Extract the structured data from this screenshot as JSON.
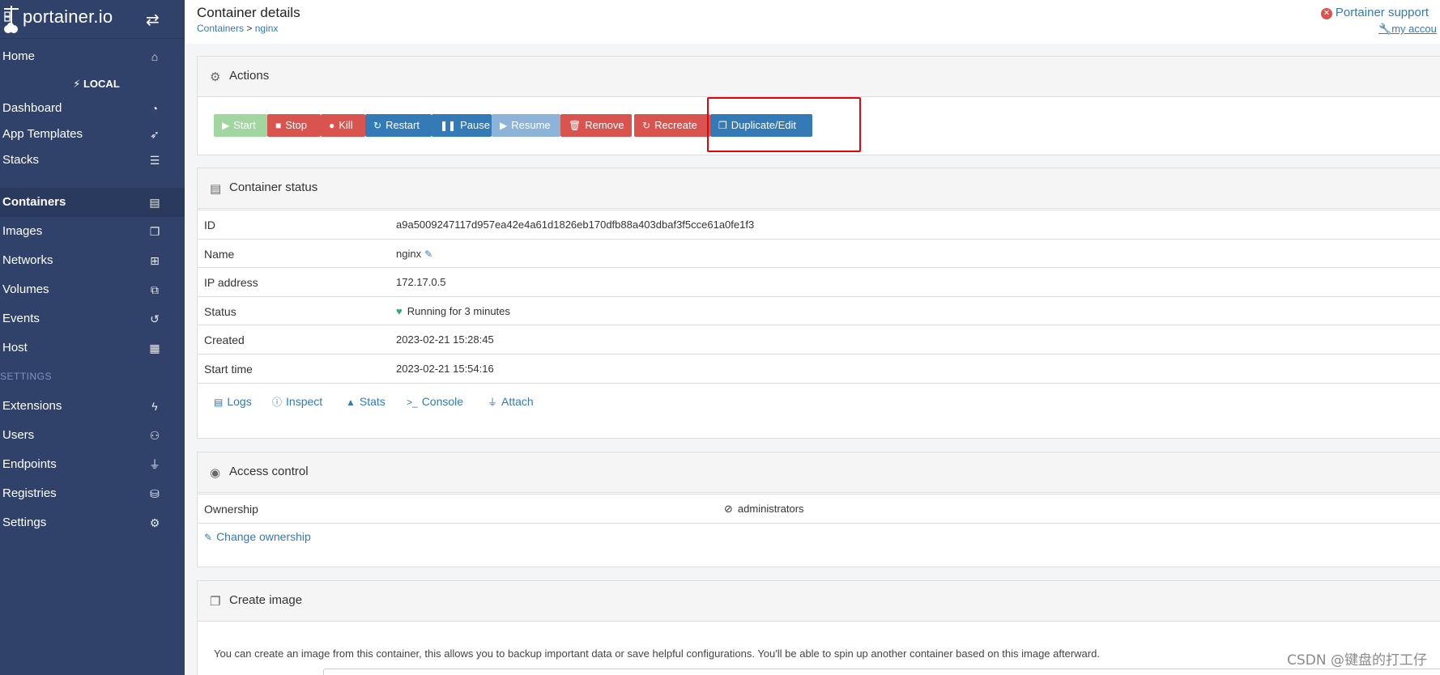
{
  "brand": {
    "name": "portainer.io"
  },
  "sidebar": {
    "home": "Home",
    "endpoint": "LOCAL",
    "items": [
      {
        "label": "Dashboard",
        "icon": "tachometer-icon"
      },
      {
        "label": "App Templates",
        "icon": "rocket-icon"
      },
      {
        "label": "Stacks",
        "icon": "th-list-icon"
      },
      {
        "label": "Containers",
        "icon": "server-icon"
      },
      {
        "label": "Images",
        "icon": "clone-icon"
      },
      {
        "label": "Networks",
        "icon": "sitemap-icon"
      },
      {
        "label": "Volumes",
        "icon": "cubes-icon"
      },
      {
        "label": "Events",
        "icon": "history-icon"
      },
      {
        "label": "Host",
        "icon": "th-icon"
      }
    ],
    "settings_heading": "SETTINGS",
    "settings_items": [
      {
        "label": "Extensions",
        "icon": "bolt-icon"
      },
      {
        "label": "Users",
        "icon": "users-icon"
      },
      {
        "label": "Endpoints",
        "icon": "plug-icon"
      },
      {
        "label": "Registries",
        "icon": "database-icon"
      },
      {
        "label": "Settings",
        "icon": "cogs-icon"
      }
    ],
    "active": "Containers"
  },
  "header": {
    "title": "Container details",
    "breadcrumb": {
      "parent": "Containers",
      "separator": ">",
      "current": "nginx"
    },
    "support_link": "Portainer support",
    "account_link": "my accou"
  },
  "actions": {
    "title": "Actions",
    "buttons": {
      "start": "Start",
      "stop": "Stop",
      "kill": "Kill",
      "restart": "Restart",
      "pause": "Pause",
      "resume": "Resume",
      "remove": "Remove",
      "recreate": "Recreate",
      "duplicate": "Duplicate/Edit"
    }
  },
  "status": {
    "title": "Container status",
    "rows": {
      "id": {
        "label": "ID",
        "value": "a9a5009247117d957ea42e4a61d1826eb170dfb88a403dbaf3f5cce61a0fe1f3"
      },
      "name": {
        "label": "Name",
        "value": "nginx"
      },
      "ip": {
        "label": "IP address",
        "value": "172.17.0.5"
      },
      "status": {
        "label": "Status",
        "value": "Running for 3 minutes"
      },
      "created": {
        "label": "Created",
        "value": "2023-02-21 15:28:45"
      },
      "start": {
        "label": "Start time",
        "value": "2023-02-21 15:54:16"
      }
    },
    "links": {
      "logs": "Logs",
      "inspect": "Inspect",
      "stats": "Stats",
      "console": "Console",
      "attach": "Attach"
    }
  },
  "access": {
    "title": "Access control",
    "ownership_label": "Ownership",
    "ownership_value": "administrators",
    "change_link": "Change ownership"
  },
  "create_image": {
    "title": "Create image",
    "description": "You can create an image from this container, this allows you to backup important data or save helpful configurations. You'll be able to spin up another container based on this image afterward."
  },
  "watermark": "CSDN @键盘的打工仔",
  "colors": {
    "sidebar": "#30426a",
    "primary": "#337ab7",
    "danger": "#d9534f",
    "success": "#a1d6a1",
    "highlight": "#e8000b"
  }
}
